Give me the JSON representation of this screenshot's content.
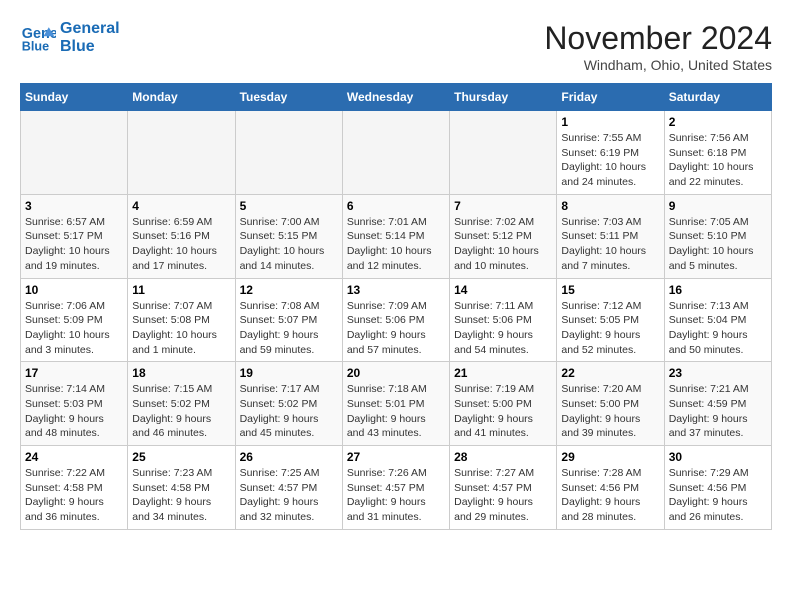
{
  "logo": {
    "line1": "General",
    "line2": "Blue"
  },
  "title": "November 2024",
  "location": "Windham, Ohio, United States",
  "days_of_week": [
    "Sunday",
    "Monday",
    "Tuesday",
    "Wednesday",
    "Thursday",
    "Friday",
    "Saturday"
  ],
  "weeks": [
    [
      {
        "day": "",
        "empty": true
      },
      {
        "day": "",
        "empty": true
      },
      {
        "day": "",
        "empty": true
      },
      {
        "day": "",
        "empty": true
      },
      {
        "day": "",
        "empty": true
      },
      {
        "day": "1",
        "sunrise": "7:55 AM",
        "sunset": "6:19 PM",
        "daylight": "10 hours and 24 minutes."
      },
      {
        "day": "2",
        "sunrise": "7:56 AM",
        "sunset": "6:18 PM",
        "daylight": "10 hours and 22 minutes."
      }
    ],
    [
      {
        "day": "3",
        "sunrise": "6:57 AM",
        "sunset": "5:17 PM",
        "daylight": "10 hours and 19 minutes."
      },
      {
        "day": "4",
        "sunrise": "6:59 AM",
        "sunset": "5:16 PM",
        "daylight": "10 hours and 17 minutes."
      },
      {
        "day": "5",
        "sunrise": "7:00 AM",
        "sunset": "5:15 PM",
        "daylight": "10 hours and 14 minutes."
      },
      {
        "day": "6",
        "sunrise": "7:01 AM",
        "sunset": "5:14 PM",
        "daylight": "10 hours and 12 minutes."
      },
      {
        "day": "7",
        "sunrise": "7:02 AM",
        "sunset": "5:12 PM",
        "daylight": "10 hours and 10 minutes."
      },
      {
        "day": "8",
        "sunrise": "7:03 AM",
        "sunset": "5:11 PM",
        "daylight": "10 hours and 7 minutes."
      },
      {
        "day": "9",
        "sunrise": "7:05 AM",
        "sunset": "5:10 PM",
        "daylight": "10 hours and 5 minutes."
      }
    ],
    [
      {
        "day": "10",
        "sunrise": "7:06 AM",
        "sunset": "5:09 PM",
        "daylight": "10 hours and 3 minutes."
      },
      {
        "day": "11",
        "sunrise": "7:07 AM",
        "sunset": "5:08 PM",
        "daylight": "10 hours and 1 minute."
      },
      {
        "day": "12",
        "sunrise": "7:08 AM",
        "sunset": "5:07 PM",
        "daylight": "9 hours and 59 minutes."
      },
      {
        "day": "13",
        "sunrise": "7:09 AM",
        "sunset": "5:06 PM",
        "daylight": "9 hours and 57 minutes."
      },
      {
        "day": "14",
        "sunrise": "7:11 AM",
        "sunset": "5:06 PM",
        "daylight": "9 hours and 54 minutes."
      },
      {
        "day": "15",
        "sunrise": "7:12 AM",
        "sunset": "5:05 PM",
        "daylight": "9 hours and 52 minutes."
      },
      {
        "day": "16",
        "sunrise": "7:13 AM",
        "sunset": "5:04 PM",
        "daylight": "9 hours and 50 minutes."
      }
    ],
    [
      {
        "day": "17",
        "sunrise": "7:14 AM",
        "sunset": "5:03 PM",
        "daylight": "9 hours and 48 minutes."
      },
      {
        "day": "18",
        "sunrise": "7:15 AM",
        "sunset": "5:02 PM",
        "daylight": "9 hours and 46 minutes."
      },
      {
        "day": "19",
        "sunrise": "7:17 AM",
        "sunset": "5:02 PM",
        "daylight": "9 hours and 45 minutes."
      },
      {
        "day": "20",
        "sunrise": "7:18 AM",
        "sunset": "5:01 PM",
        "daylight": "9 hours and 43 minutes."
      },
      {
        "day": "21",
        "sunrise": "7:19 AM",
        "sunset": "5:00 PM",
        "daylight": "9 hours and 41 minutes."
      },
      {
        "day": "22",
        "sunrise": "7:20 AM",
        "sunset": "5:00 PM",
        "daylight": "9 hours and 39 minutes."
      },
      {
        "day": "23",
        "sunrise": "7:21 AM",
        "sunset": "4:59 PM",
        "daylight": "9 hours and 37 minutes."
      }
    ],
    [
      {
        "day": "24",
        "sunrise": "7:22 AM",
        "sunset": "4:58 PM",
        "daylight": "9 hours and 36 minutes."
      },
      {
        "day": "25",
        "sunrise": "7:23 AM",
        "sunset": "4:58 PM",
        "daylight": "9 hours and 34 minutes."
      },
      {
        "day": "26",
        "sunrise": "7:25 AM",
        "sunset": "4:57 PM",
        "daylight": "9 hours and 32 minutes."
      },
      {
        "day": "27",
        "sunrise": "7:26 AM",
        "sunset": "4:57 PM",
        "daylight": "9 hours and 31 minutes."
      },
      {
        "day": "28",
        "sunrise": "7:27 AM",
        "sunset": "4:57 PM",
        "daylight": "9 hours and 29 minutes."
      },
      {
        "day": "29",
        "sunrise": "7:28 AM",
        "sunset": "4:56 PM",
        "daylight": "9 hours and 28 minutes."
      },
      {
        "day": "30",
        "sunrise": "7:29 AM",
        "sunset": "4:56 PM",
        "daylight": "9 hours and 26 minutes."
      }
    ]
  ]
}
